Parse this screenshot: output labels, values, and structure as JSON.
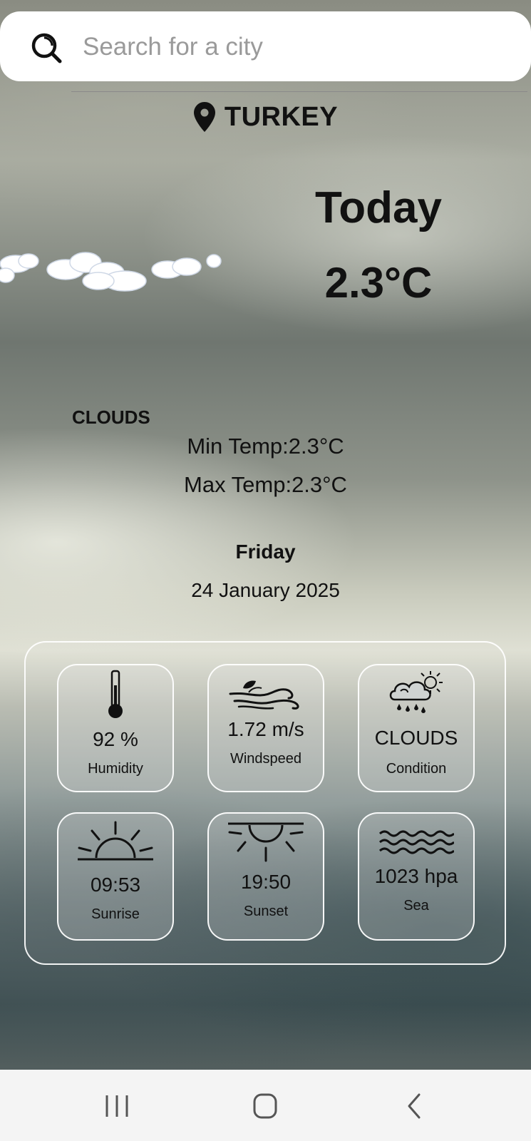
{
  "search": {
    "placeholder": "Search for a city",
    "value": ""
  },
  "location": {
    "name": "TURKEY"
  },
  "current": {
    "label": "Today",
    "temperature": "2.3°C",
    "condition": "CLOUDS",
    "min_temp": "Min Temp:2.3°C",
    "max_temp": "Max Temp:2.3°C"
  },
  "date": {
    "day": "Friday",
    "full": "24 January 2025"
  },
  "details": {
    "humidity": {
      "value": "92 %",
      "label": "Humidity",
      "icon": "thermometer-icon"
    },
    "windspeed": {
      "value": "1.72 m/s",
      "label": "Windspeed",
      "icon": "wind-icon"
    },
    "condition": {
      "value": "CLOUDS",
      "label": "Condition",
      "icon": "cloud-rain-sun-icon"
    },
    "sunrise": {
      "value": "09:53",
      "label": "Sunrise",
      "icon": "sunrise-icon"
    },
    "sunset": {
      "value": "19:50",
      "label": "Sunset",
      "icon": "sunset-icon"
    },
    "sea": {
      "value": "1023 hpa",
      "label": "Sea",
      "icon": "waves-icon"
    }
  },
  "navbar": {
    "items": [
      "recent-apps-icon",
      "home-icon",
      "back-icon"
    ]
  }
}
